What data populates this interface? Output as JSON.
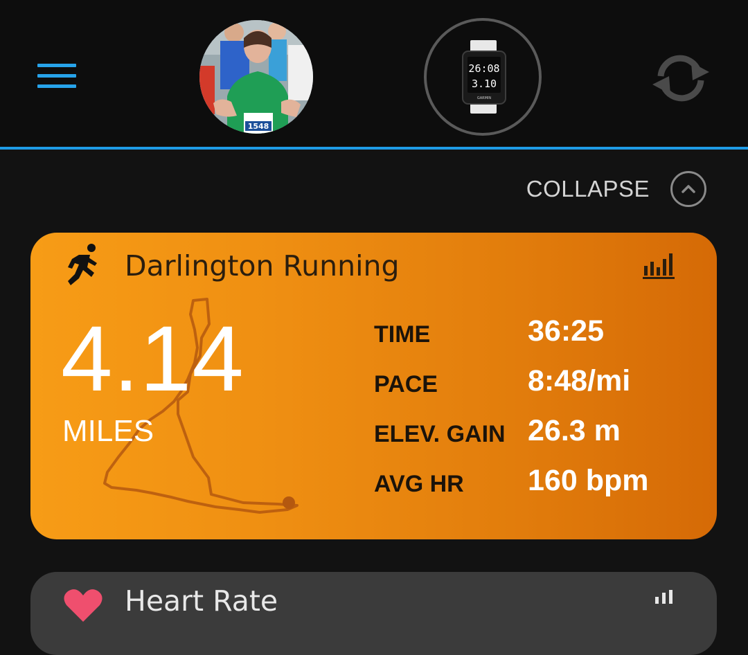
{
  "topbar": {
    "menu_icon": "hamburger-menu-icon",
    "avatar_icon": "profile-photo",
    "device": {
      "icon": "watch-device-icon",
      "screen_line1": "26:08",
      "screen_line2": "3.10",
      "brand": "GARMIN"
    },
    "sync_icon": "sync-icon",
    "accent_color": "#1e9be6"
  },
  "collapse": {
    "label": "COLLAPSE",
    "icon": "chevron-up-circle-icon"
  },
  "activity_card": {
    "icon": "running-icon",
    "title": "Darlington Running",
    "stats_icon": "bar-chart-icon",
    "distance_value": "4.14",
    "distance_unit": "MILES",
    "route_icon": "route-map",
    "stats": [
      {
        "label": "TIME",
        "value": "36:25"
      },
      {
        "label": "PACE",
        "value": "8:48/mi"
      },
      {
        "label": "ELEV. GAIN",
        "value": "26.3 m"
      },
      {
        "label": "AVG HR",
        "value": "160 bpm"
      }
    ],
    "color": "#ef8f12"
  },
  "heart_rate_card": {
    "icon": "heart-icon",
    "title": "Heart Rate",
    "stats_icon": "bar-chart-icon",
    "color": "#3b3b3b"
  }
}
